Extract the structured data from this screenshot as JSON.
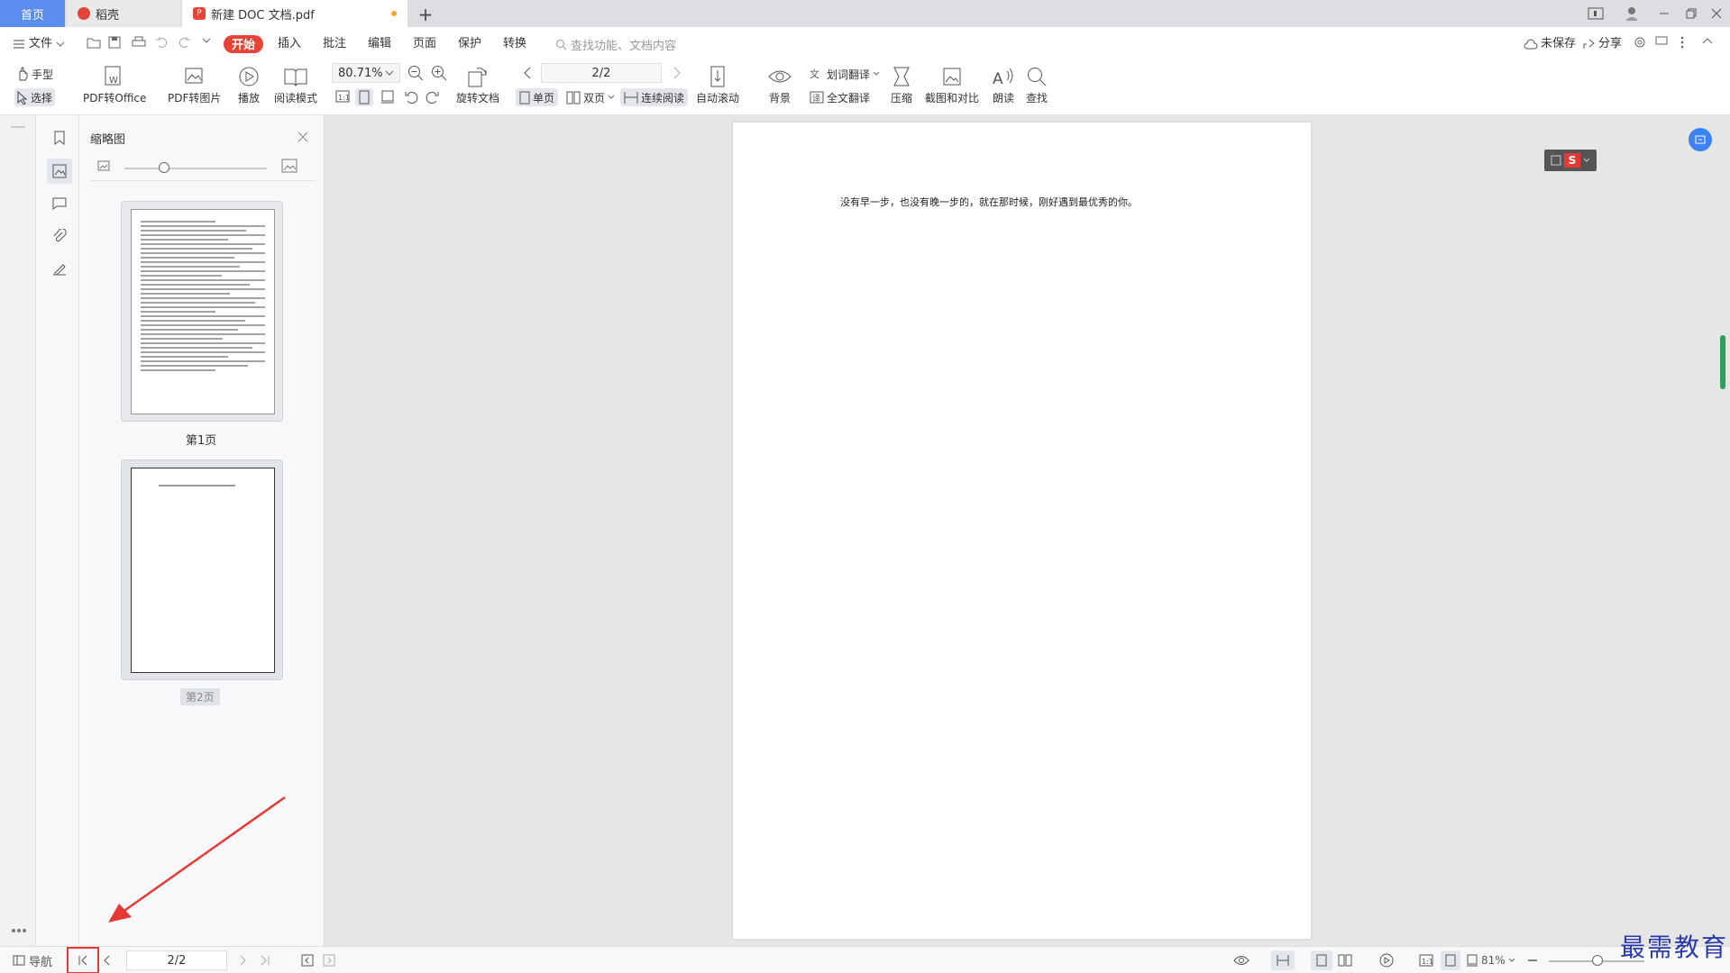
{
  "tabs": {
    "home": "首页",
    "daoke": "稻壳",
    "doc": "新建 DOC 文档.pdf"
  },
  "menu": {
    "file": "文件",
    "start": "开始",
    "insert": "插入",
    "annotate": "批注",
    "edit": "编辑",
    "page": "页面",
    "protect": "保护",
    "convert": "转换",
    "search_placeholder": "查找功能、文档内容",
    "unsaved": "未保存",
    "share": "分享"
  },
  "toolbar": {
    "hand": "手型",
    "select": "选择",
    "pdf_to_office": "PDF转Office",
    "pdf_to_image": "PDF转图片",
    "play": "播放",
    "read_mode": "阅读模式",
    "zoom": "80.71%",
    "rotate": "旋转文档",
    "page_num": "2/2",
    "single": "单页",
    "double": "双页",
    "continuous": "连续阅读",
    "autoscroll": "自动滚动",
    "background": "背景",
    "word_translate": "划词翻译",
    "full_translate": "全文翻译",
    "compress": "压缩",
    "screenshot": "截图和对比",
    "read_aloud": "朗读",
    "find": "查找"
  },
  "panel": {
    "title": "缩略图",
    "thumbs": [
      {
        "label": "第1页"
      },
      {
        "label": "第2页"
      }
    ]
  },
  "document": {
    "text": "没有早一步，也没有晚一步的，就在那时候，刚好遇到最优秀的你。"
  },
  "status": {
    "nav": "导航",
    "page": "2/2",
    "zoom": "81%"
  },
  "watermark": "最需教育",
  "colors": {
    "accent": "#5b8def",
    "start": "#e94336",
    "annotation": "#e53935"
  }
}
